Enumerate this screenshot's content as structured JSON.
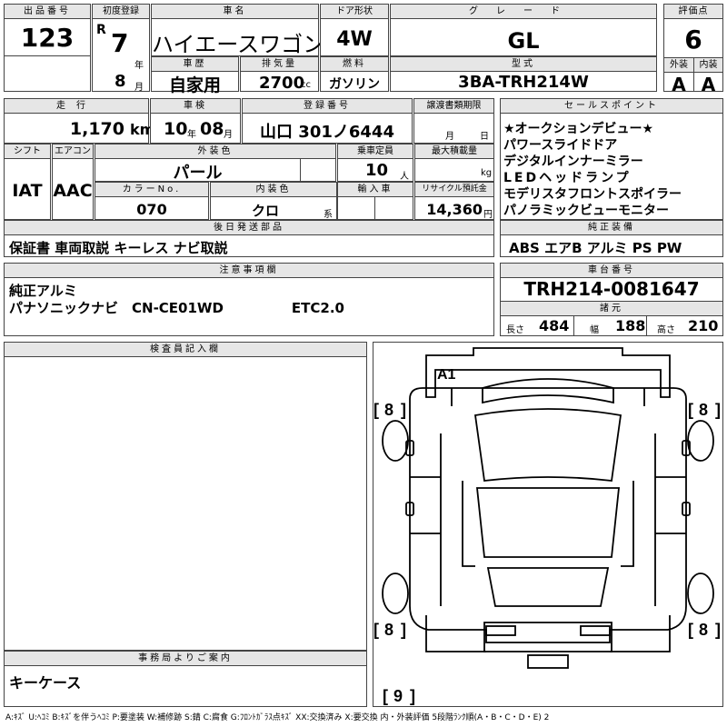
{
  "labels": {
    "lot_no": "出品番号",
    "first_reg": "初度登録",
    "car_name": "車名",
    "door": "ドア形状",
    "grade": "グレード",
    "score": "評価点",
    "exterior": "外装",
    "interior": "内装",
    "history": "車歴",
    "displacement": "排気量",
    "fuel": "燃料",
    "model": "型式",
    "mileage": "走行",
    "inspection": "車検",
    "reg_no": "登録番号",
    "transfer_deadline": "譲渡書類期限",
    "sales_points": "セールスポイント",
    "shift": "シフト",
    "ac": "エアコン",
    "ext_color": "外装色",
    "capacity": "乗車定員",
    "max_load": "最大積載量",
    "color_no": "カラーNo.",
    "int_color": "内装色",
    "import": "輸入車",
    "recycle": "リサイクル預託金",
    "later_parts": "後日発送部品",
    "genuine_equip": "純正装備",
    "notes": "注意事項欄",
    "chassis_no": "車台番号",
    "specs": "諸元",
    "inspector_notes": "検査員記入欄",
    "office_notes": "事務局よりご案内",
    "year_suffix": "年",
    "month_suffix": "月",
    "day_suffix": "日",
    "cc": "cc",
    "km": "km",
    "persons": "人",
    "kg": "kg",
    "yen": "円",
    "series": "系",
    "length": "長さ",
    "width": "幅",
    "height": "高さ"
  },
  "vehicle": {
    "lot_no": "123",
    "era": "R",
    "year": "7",
    "month": "8",
    "car_name": "ハイエースワゴン",
    "door": "4W",
    "grade": "GL",
    "score": "6",
    "exterior_grade": "A",
    "interior_grade": "A",
    "history": "自家用",
    "displacement": "2700",
    "fuel": "ガソリン",
    "model": "3BA-TRH214W",
    "mileage": "1,170",
    "inspection_year": "10",
    "inspection_month": "08",
    "reg_no": "山口 301ノ6444",
    "shift": "IAT",
    "ac": "AAC",
    "ext_color": "パール",
    "capacity": "10",
    "color_no": "070",
    "int_color": "クロ",
    "recycle": "14,360",
    "later_parts": "保証書 車両取説 キーレス ナビ取説",
    "genuine_equip": "ABS エアB アルミ PS PW",
    "notes": [
      "純正アルミ",
      "パナソニックナビ　CN-CE01WD　　　　　ETC2.0"
    ],
    "chassis_no": "TRH214-0081647",
    "length": "484",
    "width": "188",
    "height": "210",
    "office_notes": "キーケース"
  },
  "sales_points": [
    "★オークションデビュー★",
    "パワースライドドア",
    "デジタルインナーミラー",
    "LEDヘッドランプ",
    "モデリスタフロントスポイラー",
    "パノラミックビューモニター"
  ],
  "diagram": {
    "a1": "A1",
    "tire_fl": "8",
    "tire_fr": "8",
    "tire_rl": "8",
    "tire_rr": "8",
    "spare": "9"
  },
  "legend": "A:ｷｽﾞ U:ﾍｺﾐ B:ｷｽﾞを伴うﾍｺﾐ P:要塗装 W:補修跡 S:錆 C:腐食 G:ﾌﾛﾝﾄｶﾞﾗｽ点ｷｽﾞ XX:交換済み X:要交換 内・外装評価 5段階ﾗﾝｸ順(A・B・C・D・E) 2"
}
